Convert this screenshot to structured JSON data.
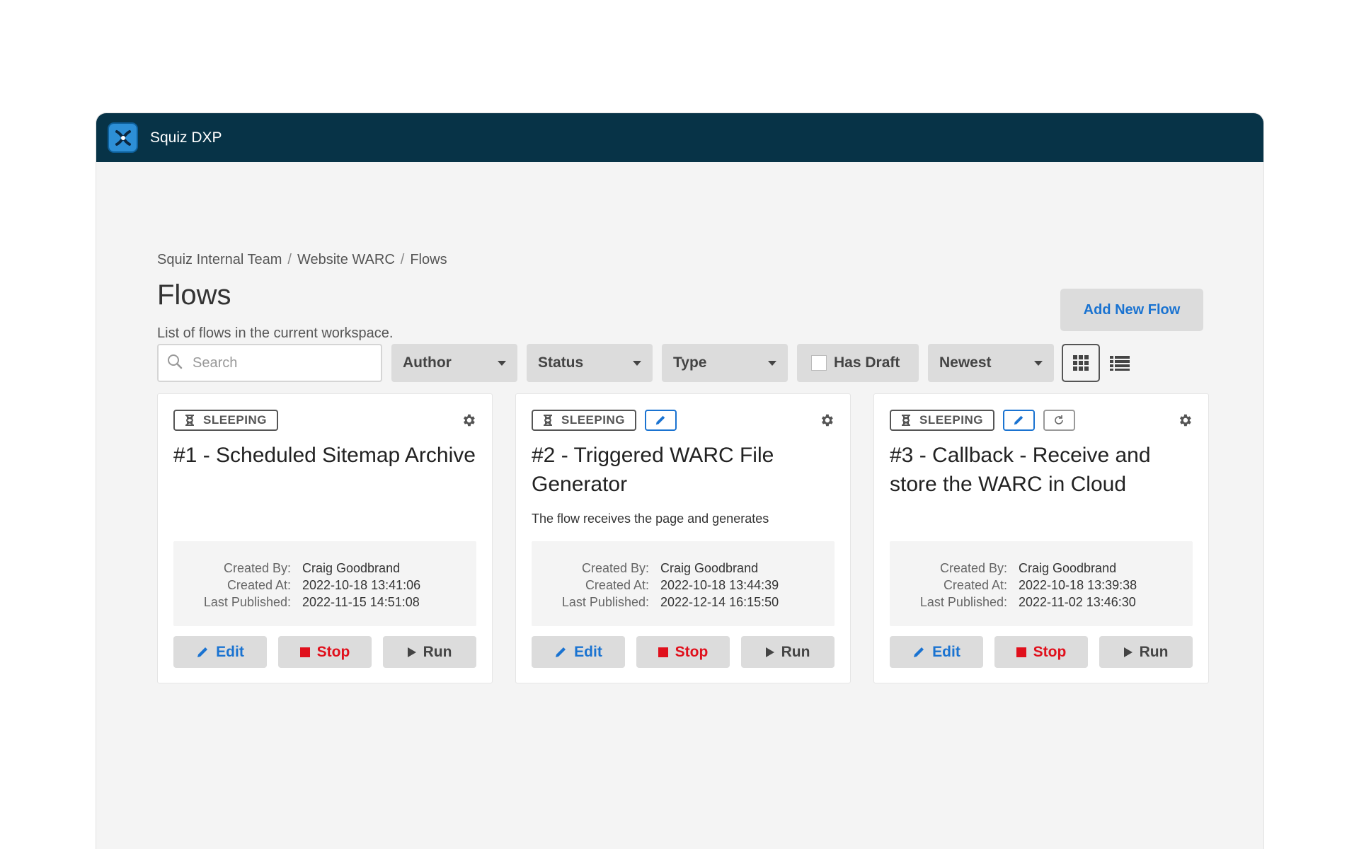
{
  "app": {
    "title": "Squiz DXP"
  },
  "breadcrumb": [
    "Squiz Internal Team",
    "Website WARC",
    "Flows"
  ],
  "page": {
    "title": "Flows",
    "subtitle": "List of flows in the current workspace.",
    "add_button": "Add New Flow"
  },
  "filters": {
    "search_placeholder": "Search",
    "author": "Author",
    "status": "Status",
    "type": "Type",
    "has_draft": "Has Draft",
    "sort": "Newest"
  },
  "labels": {
    "created_by": "Created By:",
    "created_at": "Created At:",
    "last_published": "Last Published:",
    "edit": "Edit",
    "stop": "Stop",
    "run": "Run"
  },
  "flows": [
    {
      "status": "SLEEPING",
      "title": "#1 - Scheduled Sitemap Archive",
      "description": "",
      "created_by": "Craig Goodbrand",
      "created_at": "2022-10-18 13:41:06",
      "last_published": "2022-11-15 14:51:08"
    },
    {
      "status": "SLEEPING",
      "title": "#2 - Triggered WARC File Generator",
      "description": "The flow receives the page and generates",
      "created_by": "Craig Goodbrand",
      "created_at": "2022-10-18 13:44:39",
      "last_published": "2022-12-14 16:15:50"
    },
    {
      "status": "SLEEPING",
      "title": "#3 - Callback - Receive and store the WARC in Cloud",
      "description": "",
      "created_by": "Craig Goodbrand",
      "created_at": "2022-10-18 13:39:38",
      "last_published": "2022-11-02 13:46:30"
    }
  ],
  "colors": {
    "topbar": "#073347",
    "accent": "#1a73d1",
    "danger": "#e0101c"
  }
}
